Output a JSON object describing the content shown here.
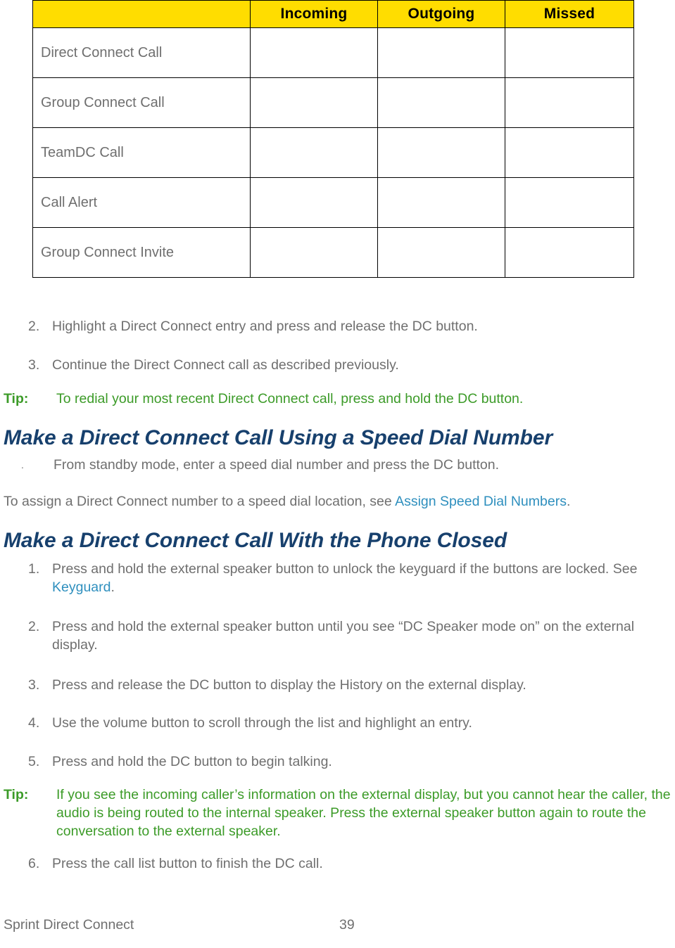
{
  "table": {
    "columns": [
      "",
      "Incoming",
      "Outgoing",
      "Missed"
    ],
    "rows": [
      {
        "label": "Direct Connect Call",
        "incoming": "",
        "outgoing": "",
        "missed": ""
      },
      {
        "label": "Group Connect Call",
        "incoming": "",
        "outgoing": "",
        "missed": ""
      },
      {
        "label": "TeamDC Call",
        "incoming": "",
        "outgoing": "",
        "missed": ""
      },
      {
        "label": "Call Alert",
        "incoming": "",
        "outgoing": "",
        "missed": ""
      },
      {
        "label": "Group Connect Invite",
        "incoming": "",
        "outgoing": "",
        "missed": ""
      }
    ]
  },
  "steps_top": [
    {
      "marker": "2.",
      "text": "Highlight a Direct Connect entry and press and release the DC button."
    },
    {
      "marker": "3.",
      "text": "Continue the Direct Connect call as described previously."
    }
  ],
  "tip1": {
    "label": "Tip:",
    "text": "To redial your most recent Direct Connect call, press and hold the DC button."
  },
  "section_speed_dial": {
    "heading": "Make a Direct Connect Call Using a Speed Dial Number",
    "bullet": {
      "marker": ".",
      "text": "From standby mode, enter a speed dial number and press the DC button."
    },
    "paragraph_prefix": "To assign a Direct Connect number to a speed dial location, see ",
    "paragraph_link": "Assign Speed Dial Numbers",
    "paragraph_suffix": "."
  },
  "section_phone_closed": {
    "heading": "Make a Direct Connect Call With the Phone Closed",
    "step1": {
      "marker": "1.",
      "text_prefix": "Press and hold the external speaker button to unlock the keyguard if the buttons are locked. See ",
      "link": "Keyguard",
      "text_suffix": "."
    },
    "steps": [
      {
        "marker": "2.",
        "text": "Press and hold the external speaker button until you see “DC Speaker mode on” on the external display."
      },
      {
        "marker": "3.",
        "text": "Press and release the DC button to display the History on the external display."
      },
      {
        "marker": "4.",
        "text": "Use the volume button to scroll through the list and highlight an entry."
      },
      {
        "marker": "5.",
        "text": "Press and hold the DC button to begin talking."
      }
    ],
    "tip2": {
      "label": "Tip:",
      "text": "If you see the incoming caller’s information on the external display, but you cannot hear the caller, the audio is being routed to the internal speaker. Press the external speaker button again to route the conversation to the external speaker."
    },
    "step6": {
      "marker": "6.",
      "text": "Press the call list button to finish the DC call."
    }
  },
  "footer": {
    "title": "Sprint Direct Connect",
    "page_number": "39"
  },
  "colors": {
    "table_header_bg": "#FFDD00",
    "heading": "#17406D",
    "body_text": "#6F6F6F",
    "tip_green": "#3C9B28",
    "link_blue": "#2E8FBE",
    "border": "#000000"
  }
}
